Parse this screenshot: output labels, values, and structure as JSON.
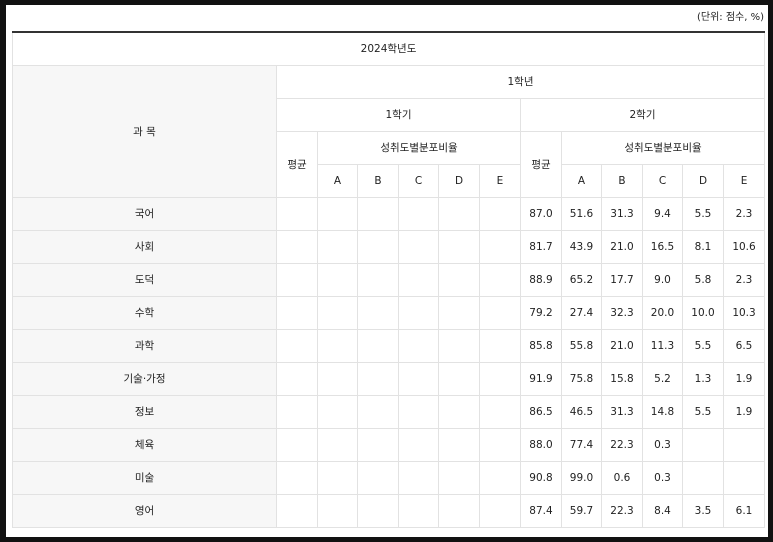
{
  "unit_label": "(단위: 점수, %)",
  "header": {
    "year": "2024학년도",
    "subject": "과 목",
    "grade": "1학년",
    "sem1": "1학기",
    "sem2": "2학기",
    "avg": "평균",
    "dist": "성취도별분포비율",
    "levels": [
      "A",
      "B",
      "C",
      "D",
      "E"
    ]
  },
  "rows": [
    {
      "subject": "국어",
      "s1": [
        "",
        "",
        "",
        "",
        "",
        ""
      ],
      "s2": [
        "87.0",
        "51.6",
        "31.3",
        "9.4",
        "5.5",
        "2.3"
      ]
    },
    {
      "subject": "사회",
      "s1": [
        "",
        "",
        "",
        "",
        "",
        ""
      ],
      "s2": [
        "81.7",
        "43.9",
        "21.0",
        "16.5",
        "8.1",
        "10.6"
      ]
    },
    {
      "subject": "도덕",
      "s1": [
        "",
        "",
        "",
        "",
        "",
        ""
      ],
      "s2": [
        "88.9",
        "65.2",
        "17.7",
        "9.0",
        "5.8",
        "2.3"
      ]
    },
    {
      "subject": "수학",
      "s1": [
        "",
        "",
        "",
        "",
        "",
        ""
      ],
      "s2": [
        "79.2",
        "27.4",
        "32.3",
        "20.0",
        "10.0",
        "10.3"
      ]
    },
    {
      "subject": "과학",
      "s1": [
        "",
        "",
        "",
        "",
        "",
        ""
      ],
      "s2": [
        "85.8",
        "55.8",
        "21.0",
        "11.3",
        "5.5",
        "6.5"
      ]
    },
    {
      "subject": "기술·가정",
      "s1": [
        "",
        "",
        "",
        "",
        "",
        ""
      ],
      "s2": [
        "91.9",
        "75.8",
        "15.8",
        "5.2",
        "1.3",
        "1.9"
      ]
    },
    {
      "subject": "정보",
      "s1": [
        "",
        "",
        "",
        "",
        "",
        ""
      ],
      "s2": [
        "86.5",
        "46.5",
        "31.3",
        "14.8",
        "5.5",
        "1.9"
      ]
    },
    {
      "subject": "체육",
      "s1": [
        "",
        "",
        "",
        "",
        "",
        ""
      ],
      "s2": [
        "88.0",
        "77.4",
        "22.3",
        "0.3",
        "",
        ""
      ]
    },
    {
      "subject": "미술",
      "s1": [
        "",
        "",
        "",
        "",
        "",
        ""
      ],
      "s2": [
        "90.8",
        "99.0",
        "0.6",
        "0.3",
        "",
        ""
      ]
    },
    {
      "subject": "영어",
      "s1": [
        "",
        "",
        "",
        "",
        "",
        ""
      ],
      "s2": [
        "87.4",
        "59.7",
        "22.3",
        "8.4",
        "3.5",
        "6.1"
      ]
    }
  ]
}
